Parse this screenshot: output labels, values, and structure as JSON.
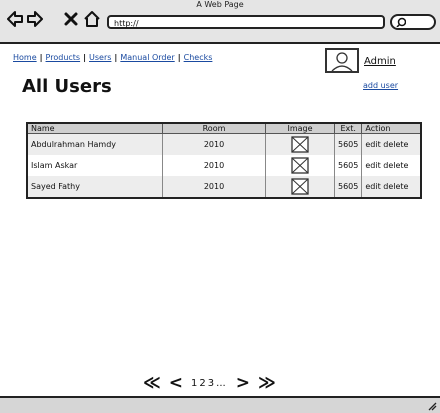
{
  "window": {
    "title": "A Web Page"
  },
  "toolbar": {
    "back_icon": "arrow-left-icon",
    "forward_icon": "arrow-right-icon",
    "stop_icon": "close-icon",
    "home_icon": "home-icon",
    "url": "http://",
    "search_icon": "search-icon"
  },
  "nav": {
    "items": [
      {
        "label": "Home"
      },
      {
        "label": "Products"
      },
      {
        "label": "Users"
      },
      {
        "label": "Manual Order"
      },
      {
        "label": "Checks"
      }
    ]
  },
  "user": {
    "name": "Admin",
    "avatar_icon": "user-avatar-icon"
  },
  "page": {
    "title": "All Users",
    "add_user_label": "add user"
  },
  "table": {
    "columns": [
      "Name",
      "Room",
      "Image",
      "Ext.",
      "Action"
    ],
    "rows": [
      {
        "name": "Abdulrahman Hamdy",
        "room": "2010",
        "ext": "5605",
        "edit": "edit",
        "delete": "delete"
      },
      {
        "name": "Islam Askar",
        "room": "2010",
        "ext": "5605",
        "edit": "edit",
        "delete": "delete"
      },
      {
        "name": "Sayed Fathy",
        "room": "2010",
        "ext": "5605",
        "edit": "edit",
        "delete": "delete"
      }
    ]
  },
  "pagination": {
    "first": "≪",
    "prev": "<",
    "pages": [
      "1",
      "2",
      "3"
    ],
    "ellipsis": "...",
    "next": ">",
    "last": "≫"
  }
}
